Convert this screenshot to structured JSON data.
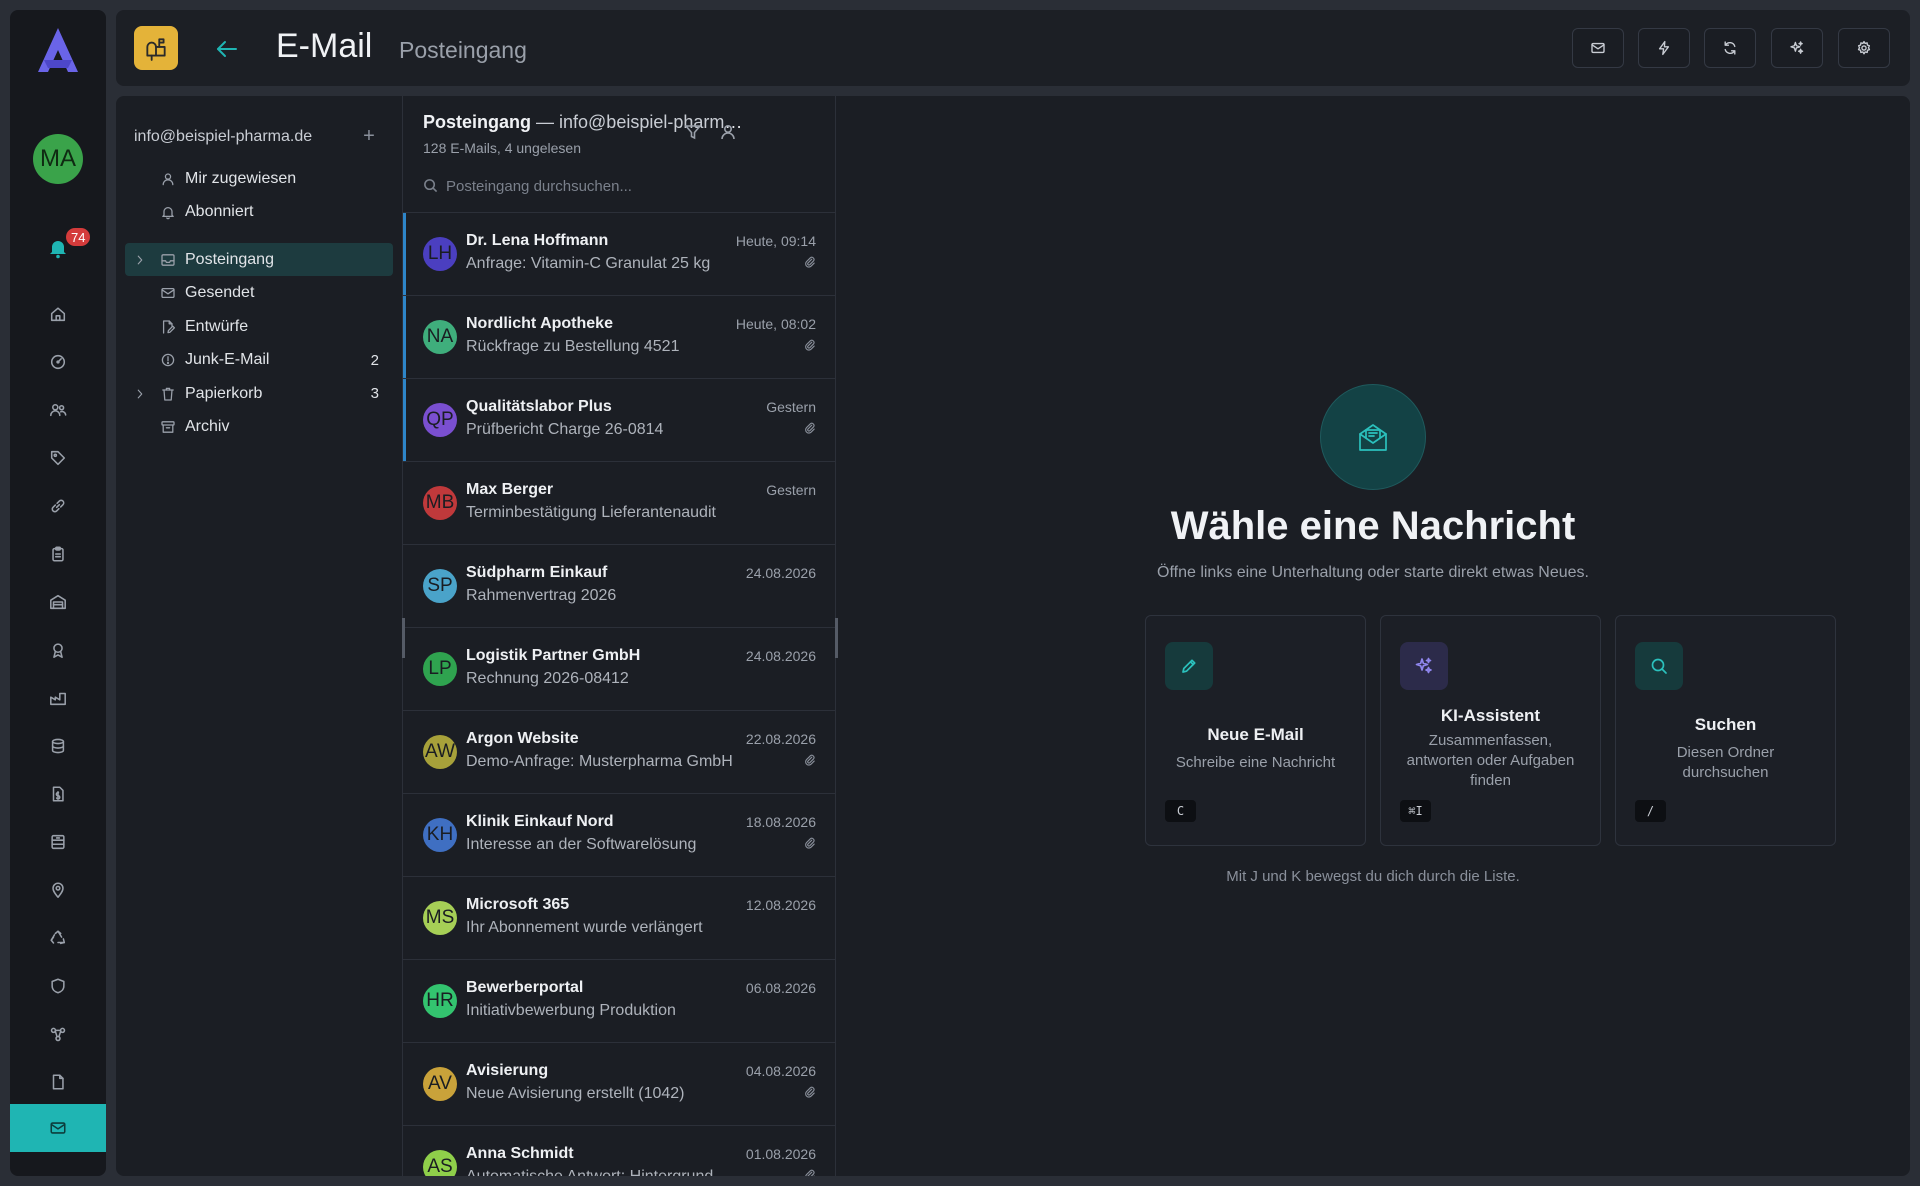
{
  "rail": {
    "avatar_initials": "MA",
    "notification_count": "74",
    "items": [
      {
        "icon": "home-icon"
      },
      {
        "icon": "dashboard-icon"
      },
      {
        "icon": "users-icon"
      },
      {
        "icon": "tag-icon"
      },
      {
        "icon": "link-icon"
      },
      {
        "icon": "clipboard-icon"
      },
      {
        "icon": "warehouse-icon"
      },
      {
        "icon": "award-icon"
      },
      {
        "icon": "factory-icon"
      },
      {
        "icon": "database-icon"
      },
      {
        "icon": "invoice-icon"
      },
      {
        "icon": "archive-box-icon"
      },
      {
        "icon": "location-icon"
      },
      {
        "icon": "recycle-icon"
      },
      {
        "icon": "shield-icon"
      },
      {
        "icon": "workflow-icon"
      },
      {
        "icon": "file-icon"
      },
      {
        "icon": "mail-icon",
        "active": true
      }
    ]
  },
  "header": {
    "title": "E-Mail",
    "subtitle": "Posteingang",
    "buttons": [
      "mail-icon",
      "bolt-icon",
      "refresh-icon",
      "sparkles-icon",
      "gear-icon"
    ]
  },
  "folders": {
    "account": "info@beispiel-pharma.de",
    "add_symbol": "+",
    "quick": [
      {
        "label": "Mir zugewiesen",
        "icon": "user-icon"
      },
      {
        "label": "Abonniert",
        "icon": "bell-icon"
      }
    ],
    "items": [
      {
        "label": "Posteingang",
        "icon": "inbox-icon",
        "count": "",
        "expandable": true,
        "active": true
      },
      {
        "label": "Gesendet",
        "icon": "mail-icon",
        "count": "",
        "expandable": false
      },
      {
        "label": "Entwürfe",
        "icon": "draft-icon",
        "count": "",
        "expandable": false
      },
      {
        "label": "Junk-E-Mail",
        "icon": "alert-icon",
        "count": "2",
        "expandable": false
      },
      {
        "label": "Papierkorb",
        "icon": "trash-icon",
        "count": "3",
        "expandable": true
      },
      {
        "label": "Archiv",
        "icon": "archive-icon",
        "count": "",
        "expandable": false
      }
    ]
  },
  "list": {
    "folder": "Posteingang",
    "account_suffix": " — info@beispiel-pharma.de",
    "summary": "128 E-Mails, 4 ungelesen",
    "search_placeholder": "Posteingang durchsuchen...",
    "messages": [
      {
        "initials": "LH",
        "color": "#4b3fc0",
        "from": "Dr. Lena Hoffmann",
        "subject": "Anfrage: Vitamin-C Granulat 25 kg",
        "date": "Heute, 09:14",
        "attachment": true,
        "unread": true
      },
      {
        "initials": "NA",
        "color": "#3fae7c",
        "from": "Nordlicht Apotheke",
        "subject": "Rückfrage zu Bestellung 4521",
        "date": "Heute, 08:02",
        "attachment": true,
        "unread": true
      },
      {
        "initials": "QP",
        "color": "#7a4fd0",
        "from": "Qualitätslabor Plus",
        "subject": "Prüfbericht Charge 26-0814",
        "date": "Gestern",
        "attachment": true,
        "unread": true
      },
      {
        "initials": "MB",
        "color": "#c0393b",
        "from": "Max Berger",
        "subject": "Terminbestätigung Lieferantenaudit",
        "date": "Gestern",
        "attachment": false,
        "unread": false
      },
      {
        "initials": "SP",
        "color": "#4aa3c9",
        "from": "Südpharm Einkauf",
        "subject": "Rahmenvertrag 2026",
        "date": "24.08.2026",
        "attachment": false,
        "unread": false
      },
      {
        "initials": "LP",
        "color": "#2fa34f",
        "from": "Logistik Partner GmbH",
        "subject": "Rechnung 2026-08412",
        "date": "24.08.2026",
        "attachment": false,
        "unread": false
      },
      {
        "initials": "AW",
        "color": "#a7a13a",
        "from": "Argon Website",
        "subject": "Demo-Anfrage: Musterpharma GmbH",
        "date": "22.08.2026",
        "attachment": true,
        "unread": false
      },
      {
        "initials": "KH",
        "color": "#3f6fc2",
        "from": "Klinik Einkauf Nord",
        "subject": "Interesse an der Softwarelösung",
        "date": "18.08.2026",
        "attachment": true,
        "unread": false
      },
      {
        "initials": "MS",
        "color": "#a6cf56",
        "from": "Microsoft 365",
        "subject": "Ihr Abonnement wurde verlängert",
        "date": "12.08.2026",
        "attachment": false,
        "unread": false
      },
      {
        "initials": "HR",
        "color": "#33c46f",
        "from": "Bewerberportal",
        "subject": "Initiativbewerbung Produktion",
        "date": "06.08.2026",
        "attachment": false,
        "unread": false
      },
      {
        "initials": "AV",
        "color": "#c9a23a",
        "from": "Avisierung",
        "subject": "Neue Avisierung erstellt (1042)",
        "date": "04.08.2026",
        "attachment": true,
        "unread": false
      },
      {
        "initials": "AS",
        "color": "#8fcf4a",
        "from": "Anna Schmidt",
        "subject": "Automatische Antwort: Hintergrund-",
        "date": "01.08.2026",
        "attachment": true,
        "unread": false
      }
    ]
  },
  "empty_state": {
    "title": "Wähle eine Nachricht",
    "subtitle": "Öffne links eine Unterhaltung oder starte direkt etwas Neues.",
    "cards": [
      {
        "title": "Neue E-Mail",
        "description": "Schreibe eine Nachricht",
        "shortcut": "C",
        "icon": "pencil-icon"
      },
      {
        "title": "KI-Assistent",
        "description": "Zusammenfassen, antworten oder Aufgaben finden",
        "shortcut": "⌘I",
        "icon": "sparkles-icon"
      },
      {
        "title": "Suchen",
        "description": "Diesen Ordner durchsuchen",
        "shortcut": "/",
        "icon": "search-icon"
      }
    ],
    "hint": "Mit J und K bewegst du dich durch die Liste."
  }
}
